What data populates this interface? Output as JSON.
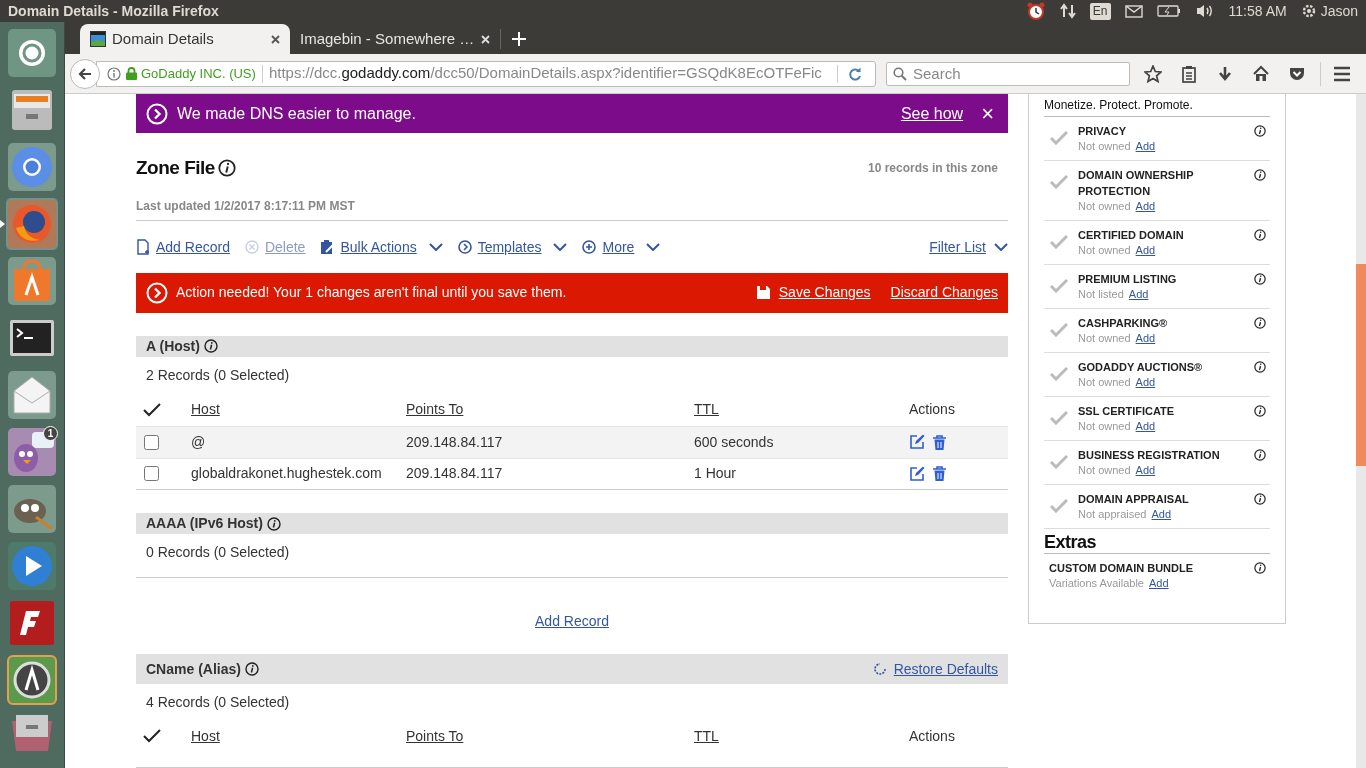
{
  "panel": {
    "window_title": "Domain Details - Mozilla Firefox",
    "keyboard": "En",
    "time": "11:58 AM",
    "user": "Jason"
  },
  "launcher": {
    "items": [
      {
        "kind": "dash",
        "active": false
      },
      {
        "kind": "files",
        "active": false
      },
      {
        "kind": "chromium",
        "active": false
      },
      {
        "kind": "firefox",
        "active": true
      },
      {
        "kind": "software",
        "active": false
      },
      {
        "kind": "terminal",
        "active": false
      },
      {
        "kind": "mail",
        "active": false
      },
      {
        "kind": "pidgin",
        "active": false,
        "badge": "1"
      },
      {
        "kind": "gimp",
        "active": false
      },
      {
        "kind": "player",
        "active": false
      },
      {
        "kind": "filezilla",
        "active": false
      },
      {
        "kind": "updater",
        "active": false
      },
      {
        "kind": "drawer",
        "active": false
      }
    ]
  },
  "browser": {
    "tabs": [
      {
        "title": "Domain Details",
        "selected": true
      },
      {
        "title": "Imagebin - Somewhere …",
        "selected": false
      }
    ],
    "identity": "GoDaddy INC. (US)",
    "url_prefix": "https://dcc.",
    "url_domain": "godaddy.com",
    "url_path": "/dcc50/DomainDetails.aspx?identifier=GSQdK8EcOTFeFic",
    "search_placeholder": "Search"
  },
  "banner": {
    "text": "We made DNS easier to manage.",
    "link": "See how",
    "close": "×"
  },
  "zone_file": {
    "title": "Zone File",
    "count": "10 records in this zone",
    "last_updated": "Last updated 1/2/2017 8:17:11 PM MST"
  },
  "toolbar": {
    "actions": [
      {
        "kind": "add",
        "label": "Add Record",
        "disabled": false,
        "dropdown": false
      },
      {
        "kind": "delete",
        "label": "Delete",
        "disabled": true,
        "dropdown": false
      },
      {
        "kind": "bulk",
        "label": "Bulk Actions",
        "disabled": false,
        "dropdown": true
      },
      {
        "kind": "templates",
        "label": "Templates",
        "disabled": false,
        "dropdown": true
      },
      {
        "kind": "more",
        "label": "More",
        "disabled": false,
        "dropdown": true
      }
    ],
    "filter": "Filter List"
  },
  "alert": {
    "text": "Action needed! Your 1 changes aren't final until you save them.",
    "save": "Save Changes",
    "discard": "Discard Changes"
  },
  "sections": [
    {
      "title": "A (Host)",
      "count": "2 Records (0 Selected)",
      "columns": [
        "Host",
        "Points To",
        "TTL",
        "Actions"
      ],
      "rows": [
        {
          "host": "@",
          "points_to": "209.148.84.117",
          "ttl": "600 seconds",
          "checked": false,
          "hovered": true
        },
        {
          "host": "globaldrakonet.hughestek.com",
          "points_to": "209.148.84.117",
          "ttl": "1 Hour",
          "checked": false,
          "hovered": false
        }
      ]
    },
    {
      "title": "AAAA (IPv6 Host)",
      "count": "0 Records (0 Selected)",
      "add_record": "Add Record"
    },
    {
      "title": "CName (Alias)",
      "restore": "Restore Defaults",
      "count": "4 Records (0 Selected)",
      "columns": [
        "Host",
        "Points To",
        "TTL",
        "Actions"
      ]
    }
  ],
  "sidebar": {
    "heading": "Monetize. Protect. Promote.",
    "items": [
      {
        "name": "PRIVACY",
        "status": "Not owned",
        "action": "Add"
      },
      {
        "name": "DOMAIN OWNERSHIP PROTECTION",
        "status": "Not owned",
        "action": "Add"
      },
      {
        "name": "CERTIFIED DOMAIN",
        "status": "Not owned",
        "action": "Add"
      },
      {
        "name": "PREMIUM LISTING",
        "status": "Not listed",
        "action": "Add"
      },
      {
        "name": "CASHPARKING®",
        "status": "Not owned",
        "action": "Add"
      },
      {
        "name": "GODADDY AUCTIONS®",
        "status": "Not owned",
        "action": "Add"
      },
      {
        "name": "SSL CERTIFICATE",
        "status": "Not owned",
        "action": "Add"
      },
      {
        "name": "BUSINESS REGISTRATION",
        "status": "Not owned",
        "action": "Add"
      },
      {
        "name": "DOMAIN APPRAISAL",
        "status": "Not appraised",
        "action": "Add"
      }
    ],
    "extras_heading": "Extras",
    "extras": [
      {
        "name": "CUSTOM DOMAIN BUNDLE",
        "status": "Variations Available",
        "action": "Add"
      }
    ]
  }
}
